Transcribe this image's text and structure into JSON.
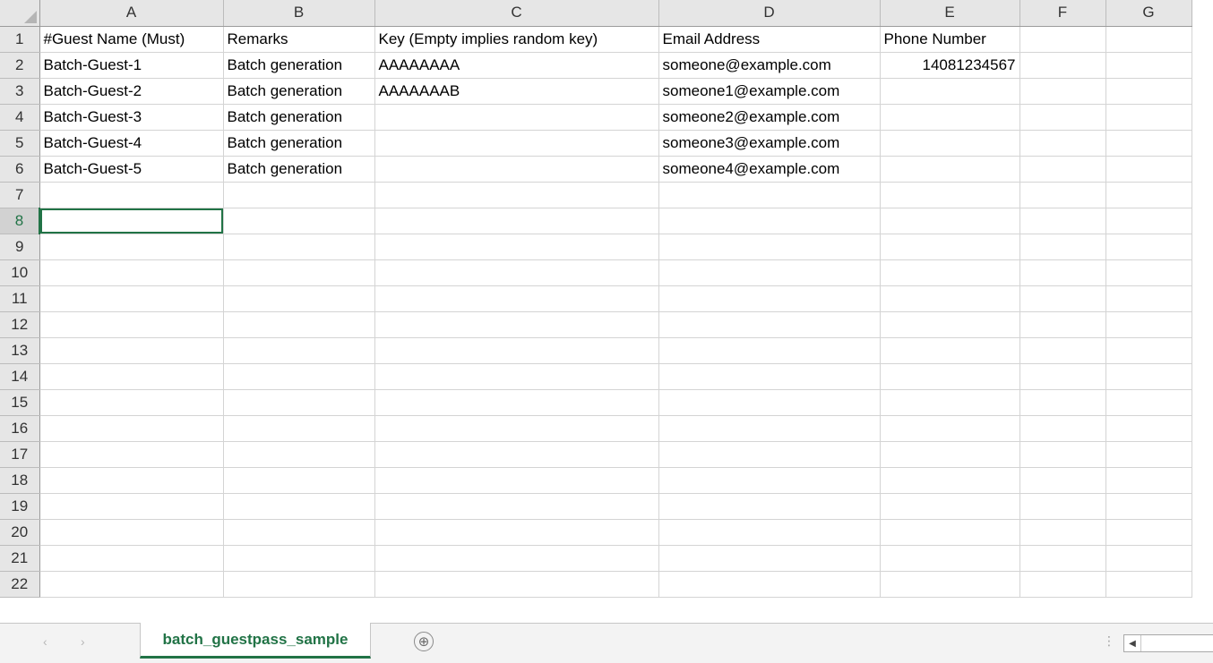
{
  "columns": [
    "A",
    "B",
    "C",
    "D",
    "E",
    "F",
    "G"
  ],
  "rows": [
    {
      "num": "1",
      "cells": [
        "#Guest Name (Must)",
        "Remarks",
        "Key (Empty implies random key)",
        " Email Address",
        "Phone Number",
        "",
        ""
      ]
    },
    {
      "num": "2",
      "cells": [
        "Batch-Guest-1",
        "Batch generation",
        "AAAAAAAA",
        "someone@example.com",
        "14081234567",
        "",
        ""
      ]
    },
    {
      "num": "3",
      "cells": [
        "Batch-Guest-2",
        "Batch generation",
        "AAAAAAAB",
        "someone1@example.com",
        "",
        "",
        ""
      ]
    },
    {
      "num": "4",
      "cells": [
        "Batch-Guest-3",
        "Batch generation",
        "",
        "someone2@example.com",
        "",
        "",
        ""
      ]
    },
    {
      "num": "5",
      "cells": [
        "Batch-Guest-4",
        "Batch generation",
        "",
        "someone3@example.com",
        "",
        "",
        ""
      ]
    },
    {
      "num": "6",
      "cells": [
        "Batch-Guest-5",
        "Batch generation",
        "",
        "someone4@example.com",
        "",
        "",
        ""
      ]
    },
    {
      "num": "7",
      "cells": [
        "",
        "",
        "",
        "",
        "",
        "",
        ""
      ]
    },
    {
      "num": "8",
      "cells": [
        "",
        "",
        "",
        "",
        "",
        "",
        ""
      ]
    },
    {
      "num": "9",
      "cells": [
        "",
        "",
        "",
        "",
        "",
        "",
        ""
      ]
    },
    {
      "num": "10",
      "cells": [
        "",
        "",
        "",
        "",
        "",
        "",
        ""
      ]
    },
    {
      "num": "11",
      "cells": [
        "",
        "",
        "",
        "",
        "",
        "",
        ""
      ]
    },
    {
      "num": "12",
      "cells": [
        "",
        "",
        "",
        "",
        "",
        "",
        ""
      ]
    },
    {
      "num": "13",
      "cells": [
        "",
        "",
        "",
        "",
        "",
        "",
        ""
      ]
    },
    {
      "num": "14",
      "cells": [
        "",
        "",
        "",
        "",
        "",
        "",
        ""
      ]
    },
    {
      "num": "15",
      "cells": [
        "",
        "",
        "",
        "",
        "",
        "",
        ""
      ]
    },
    {
      "num": "16",
      "cells": [
        "",
        "",
        "",
        "",
        "",
        "",
        ""
      ]
    },
    {
      "num": "17",
      "cells": [
        "",
        "",
        "",
        "",
        "",
        "",
        ""
      ]
    },
    {
      "num": "18",
      "cells": [
        "",
        "",
        "",
        "",
        "",
        "",
        ""
      ]
    },
    {
      "num": "19",
      "cells": [
        "",
        "",
        "",
        "",
        "",
        "",
        ""
      ]
    },
    {
      "num": "20",
      "cells": [
        "",
        "",
        "",
        "",
        "",
        "",
        ""
      ]
    },
    {
      "num": "21",
      "cells": [
        "",
        "",
        "",
        "",
        "",
        "",
        ""
      ]
    },
    {
      "num": "22",
      "cells": [
        "",
        "",
        "",
        "",
        "",
        "",
        ""
      ]
    }
  ],
  "active_cell": {
    "row": "8",
    "column": "A"
  },
  "sheet_tab": {
    "label": "batch_guestpass_sample"
  },
  "icons": {
    "add_sheet": "⊕",
    "scroll_left": "◀",
    "prev_sheet": "‹",
    "next_sheet": "›",
    "more": "⋮"
  },
  "colors": {
    "accent": "#217346"
  }
}
